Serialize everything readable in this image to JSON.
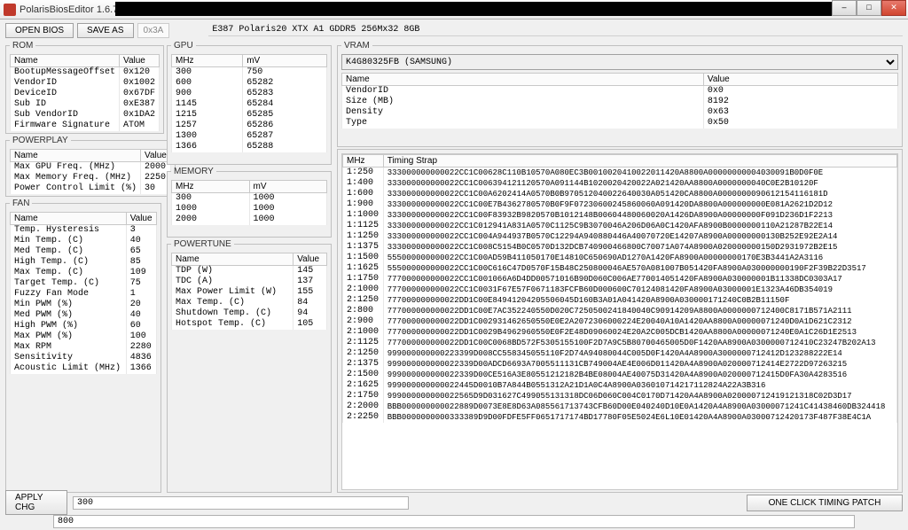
{
  "window": {
    "title": "PolarisBiosEditor 1.6.7"
  },
  "toolbar": {
    "open": "OPEN BIOS",
    "save": "SAVE AS",
    "hex": "0x3A",
    "device": "E387 Polaris20 XTX A1 GDDR5 256Mx32 8GB"
  },
  "rom": {
    "legend": "ROM",
    "header": [
      "Name",
      "Value"
    ],
    "rows": [
      [
        "BootupMessageOffset",
        "0x120"
      ],
      [
        "VendorID",
        "0x1002"
      ],
      [
        "DeviceID",
        "0x67DF"
      ],
      [
        "Sub ID",
        "0xE387"
      ],
      [
        "Sub VendorID",
        "0x1DA2"
      ],
      [
        "Firmware Signature",
        "ATOM"
      ]
    ]
  },
  "powerplay": {
    "legend": "POWERPLAY",
    "header": [
      "Name",
      "Value"
    ],
    "rows": [
      [
        "Max GPU Freq. (MHz)",
        "2000"
      ],
      [
        "Max Memory Freq. (MHz)",
        "2250"
      ],
      [
        "Power Control Limit (%)",
        "30"
      ]
    ]
  },
  "fan": {
    "legend": "FAN",
    "header": [
      "Name",
      "Value"
    ],
    "rows": [
      [
        "Temp. Hysteresis",
        "3"
      ],
      [
        "Min Temp. (C)",
        "40"
      ],
      [
        "Med Temp. (C)",
        "65"
      ],
      [
        "High Temp. (C)",
        "85"
      ],
      [
        "Max Temp. (C)",
        "109"
      ],
      [
        "Target Temp. (C)",
        "75"
      ],
      [
        "Fuzzy Fan Mode",
        "1"
      ],
      [
        "Min PWM (%)",
        "20"
      ],
      [
        "Med PWM (%)",
        "40"
      ],
      [
        "High PWM (%)",
        "60"
      ],
      [
        "Max PWM (%)",
        "100"
      ],
      [
        "Max RPM",
        "2280"
      ],
      [
        "Sensitivity",
        "4836"
      ],
      [
        "Acoustic Limit (MHz)",
        "1366"
      ]
    ]
  },
  "gpu": {
    "legend": "GPU",
    "header": [
      "MHz",
      "mV"
    ],
    "rows": [
      [
        "300",
        "750"
      ],
      [
        "600",
        "65282"
      ],
      [
        "900",
        "65283"
      ],
      [
        "1145",
        "65284"
      ],
      [
        "1215",
        "65285"
      ],
      [
        "1257",
        "65286"
      ],
      [
        "1300",
        "65287"
      ],
      [
        "1366",
        "65288"
      ]
    ]
  },
  "memory": {
    "legend": "MEMORY",
    "header": [
      "MHz",
      "mV"
    ],
    "rows": [
      [
        "300",
        "1000"
      ],
      [
        "1000",
        "1000"
      ],
      [
        "2000",
        "1000"
      ]
    ]
  },
  "powertune": {
    "legend": "POWERTUNE",
    "header": [
      "Name",
      "Value"
    ],
    "rows": [
      [
        "TDP (W)",
        "145"
      ],
      [
        "TDC (A)",
        "137"
      ],
      [
        "Max Power Limit (W)",
        "155"
      ],
      [
        "Max Temp. (C)",
        "84"
      ],
      [
        "Shutdown Temp. (C)",
        "94"
      ],
      [
        "Hotspot Temp. (C)",
        "105"
      ]
    ]
  },
  "vram": {
    "legend": "VRAM",
    "selected": "K4G80325FB (SAMSUNG)",
    "header": [
      "Name",
      "Value"
    ],
    "rows": [
      [
        "VendorID",
        "0x0"
      ],
      [
        "Size (MB)",
        "8192"
      ],
      [
        "Density",
        "0x63"
      ],
      [
        "Type",
        "0x50"
      ]
    ]
  },
  "timings": {
    "header": [
      "MHz",
      "Timing Strap"
    ],
    "rows": [
      [
        "1:250",
        "333000000000022CC1C00628C110B10570A080EC3B0010020410022011420A8800A00000000004030091B0D0F0E"
      ],
      [
        "1:400",
        "333000000000022CC1C006394121120570A091144B1020020420022A021420AA8800A0000000040C0E2B10120F"
      ],
      [
        "1:600",
        "333000000000022CC1C00A6202414A0570B0B970512040022640030A051420CA8800A0000000090612154116181D"
      ],
      [
        "1:900",
        "333000000000022CC1C00E7B4362780570B0F9F07230600245860060A091420DA8800A000000000E081A2621D2D12"
      ],
      [
        "1:1000",
        "333000000000022CC1C00F83932B9820570B1012148B00604480060020A1426DA8900A00000000F091D236D1F2213"
      ],
      [
        "1:1125",
        "333000000000022CC1C012941A831A0570C1125C9B3070046A206D06A0C1420AFA8900B0000000110A21287B22E14"
      ],
      [
        "1:1250",
        "333000000000022CC1C004A944937B0570C12294A940880446A40070720E14207A8900A00000000130B252E92E2A14"
      ],
      [
        "1:1375",
        "333000000000022CC1C008C5154B0C0570D132DCB740900466800C70071A074A8900A020000000150D2931972B2E15"
      ],
      [
        "1:1500",
        "555000000000022CC1C00AD59B411050170E14810C650690AD1270A1420FA8900A00000000170E3B3441A2A3116"
      ],
      [
        "1:1625",
        "555000000000022CC1C00C616C47D0570F15B48C250800046AE570A081007B051420FA8900A030000000190F2F39B22D3517"
      ],
      [
        "1:1750",
        "777000000000022CC1C001066A6D4DD00571016B90D060C006AE770014051420FA8900A030000001B11338DC0303A17"
      ],
      [
        "2:1000",
        "777000000000022CC1C0031F67E57F0671183FCFB60D000600C70124081420FA8900A03000001E1323A46DB354019"
      ],
      [
        "2:1250",
        "777000000000022DD1C00E84941204205506045D160B3A01A041420A8900A030000171240C0B2B11150F"
      ],
      [
        "2:800",
        "777000000000022DD1C00E7AC352240550D020C7250500241840040C90914209A8800A0000000712400C8171B571A2111"
      ],
      [
        "2:900",
        "777000000000022DD1C002931462650550E0E2A2072306000224E20040A10A1420AA8800A00000071240D0A1D621C2312"
      ],
      [
        "2:1000",
        "777000000000022DD1C0029B4962960550E0F2E48D09060024E20A2C005DCB1420AA8800A00000071240E0A1C26D1E2513"
      ],
      [
        "2:1125",
        "777000000000022DD1C00C0068BD572F5305155100F2D7A9C5B80700465005D0F1420AA8900A0300000712410C23247B202A13"
      ],
      [
        "2:1250",
        "999000000000223399D008CC558345055110F2D74A94080044C005D0F1420A4A8900A3000000712412D123288222E14"
      ],
      [
        "2:1375",
        "999000000000022339D00ADCD6693A7005511131CB749004AE4E006D011420A4A8900A020000712414E2722D97263215"
      ],
      [
        "2:1500",
        "999000000000022339D00CE516A3E80551212182B4BE08004AE40075D31420A4A8900A020000712415D0FA30A4283516"
      ],
      [
        "2:1625",
        "999000000000022445D0010B7A844B0551312A21D1A0C4A8900A036010714217112824A22A3B316"
      ],
      [
        "2:1750",
        "999000000000022565D9D031627C499055131318DC06D060C004C0170D71420A4A8900A020000712419121318C02D3D17"
      ],
      [
        "2:2000",
        "BBB000000000022889D0073E8E8D63A085561713743CFB60D00E040240D10E0A1420A4A8900A03000071241C41438460DB324418"
      ],
      [
        "2:2250",
        "BBB0000000000333389D9D00FDFE5FF0651717174BD17780F05E5024E6L10E01420A4A8900A03000712420173F487F38E4C1A"
      ]
    ]
  },
  "buttons": {
    "apply": "APPLY CHG",
    "patch": "ONE CLICK TIMING PATCH"
  },
  "bottom1_value": "300",
  "bottom2_value": "800"
}
